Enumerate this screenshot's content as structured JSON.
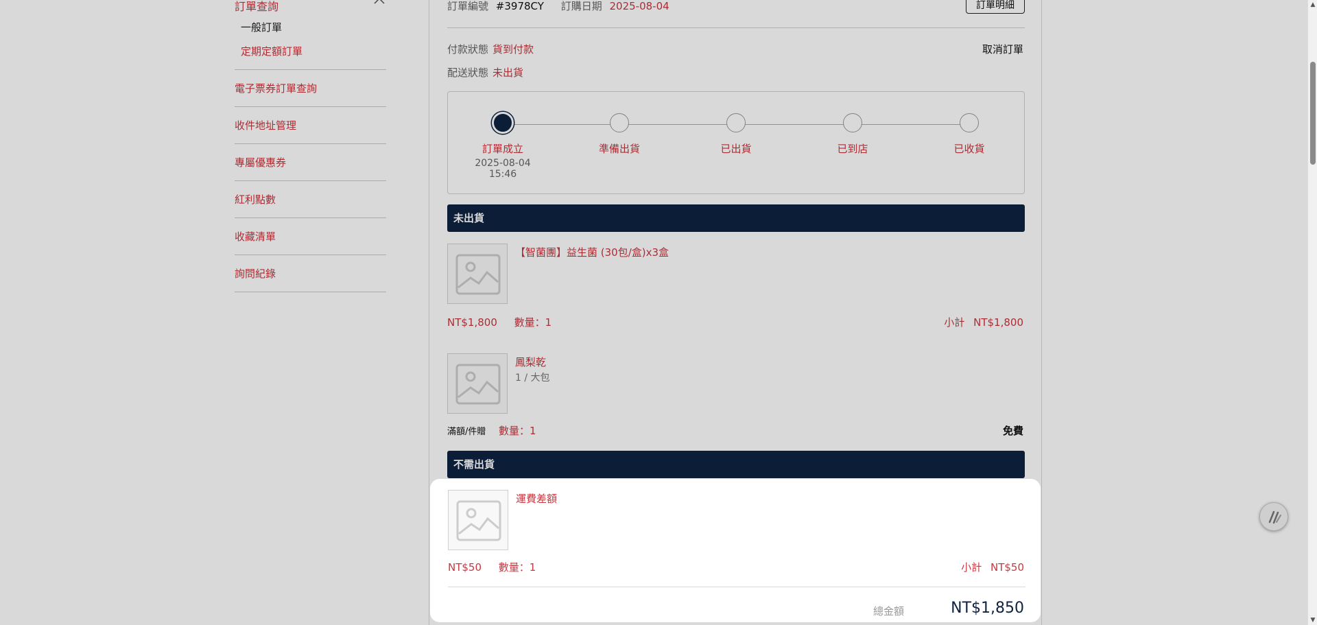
{
  "sidebar": {
    "header": "訂單查詢",
    "sub_items": [
      "一般訂單",
      "定期定額訂單"
    ],
    "items": [
      "電子票券訂單查詢",
      "收件地址管理",
      "專屬優惠券",
      "紅利點數",
      "收藏清單",
      "詢問紀錄"
    ]
  },
  "order": {
    "number_label": "訂單編號",
    "number": "#3978CY",
    "date_label": "訂購日期",
    "date": "2025-08-04",
    "detail_button": "訂單明細",
    "payment_label": "付款狀態",
    "payment_value": "貨到付款",
    "shipping_label": "配送狀態",
    "shipping_value": "未出貨",
    "cancel_label": "取消訂單"
  },
  "progress": {
    "current_step": 1,
    "steps": [
      {
        "label": "訂單成立",
        "time": "2025-08-04 15:46"
      },
      {
        "label": "準備出貨",
        "time": ""
      },
      {
        "label": "已出貨",
        "time": ""
      },
      {
        "label": "已到店",
        "time": ""
      },
      {
        "label": "已收貨",
        "time": ""
      }
    ]
  },
  "sections": {
    "unshipped": "未出貨",
    "no_shipping": "不需出貨"
  },
  "items": {
    "item1": {
      "name": "【智菌團】益生菌 (30包/盒)x3盒",
      "price": "NT$1,800",
      "qty": "數量：1",
      "subtotal_label": "小計",
      "subtotal": "NT$1,800"
    },
    "item2": {
      "name": "鳳梨乾",
      "spec": "1 / 大包",
      "tag": "滿額/件贈",
      "qty": "數量：1",
      "free": "免費"
    },
    "item3": {
      "name": "運費差額",
      "price": "NT$50",
      "qty": "數量：1",
      "subtotal_label": "小計",
      "subtotal": "NT$50"
    }
  },
  "summary": {
    "total_label": "總金額",
    "total_value": "NT$1,850"
  },
  "colors": {
    "accent": "#c9363e",
    "navy": "#0f2341"
  }
}
